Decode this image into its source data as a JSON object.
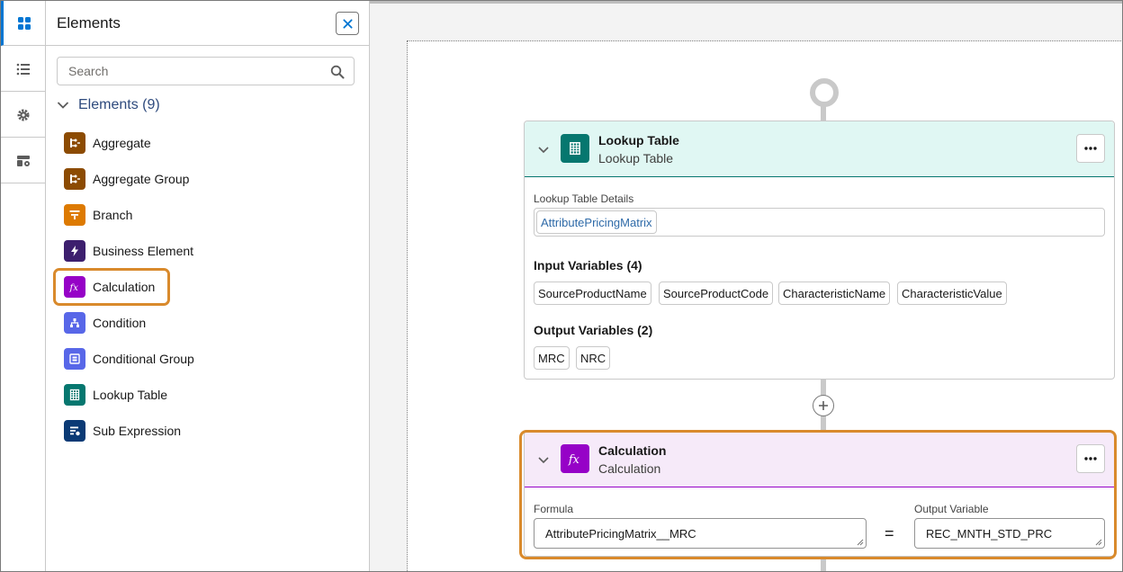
{
  "panel": {
    "title": "Elements",
    "search_placeholder": "Search",
    "section_label": "Elements (9)",
    "items": [
      {
        "label": "Aggregate",
        "icon": "aggregate-icon",
        "color": "#8c4b02"
      },
      {
        "label": "Aggregate Group",
        "icon": "aggregate-group-icon",
        "color": "#8c4b02"
      },
      {
        "label": "Branch",
        "icon": "branch-icon",
        "color": "#dd7a01"
      },
      {
        "label": "Business Element",
        "icon": "bolt-icon",
        "color": "#3d1f6e"
      },
      {
        "label": "Calculation",
        "icon": "formula-icon",
        "color": "#9602c7"
      },
      {
        "label": "Condition",
        "icon": "hierarchy-icon",
        "color": "#5867e8"
      },
      {
        "label": "Conditional Group",
        "icon": "group-icon",
        "color": "#5867e8"
      },
      {
        "label": "Lookup Table",
        "icon": "table-icon",
        "color": "#06776f"
      },
      {
        "label": "Sub Expression",
        "icon": "sub-expression-icon",
        "color": "#0b3a75"
      }
    ]
  },
  "canvas": {
    "lookup_card": {
      "title": "Lookup Table",
      "subtitle": "Lookup Table",
      "header_color": "#e0f7f3",
      "details_label": "Lookup Table Details",
      "details_value": "AttributePricingMatrix",
      "inputs_heading": "Input Variables (4)",
      "inputs": [
        "SourceProductName",
        "SourceProductCode",
        "CharacteristicName",
        "CharacteristicValue"
      ],
      "outputs_heading": "Output Variables (2)",
      "outputs": [
        "MRC",
        "NRC"
      ]
    },
    "calc_card": {
      "title": "Calculation",
      "subtitle": "Calculation",
      "header_color": "#f6eaf9",
      "formula_label": "Formula",
      "formula_value": "AttributePricingMatrix__MRC",
      "equals": "=",
      "output_label": "Output Variable",
      "output_value": "REC_MNTH_STD_PRC"
    }
  }
}
